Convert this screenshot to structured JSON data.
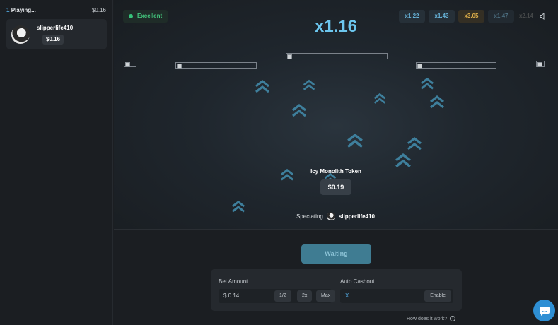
{
  "sidebar": {
    "playing_count": "1",
    "playing_label": "Playing...",
    "total": "$0.16",
    "players": [
      {
        "name": "slipperlife410",
        "bet": "$0.16"
      }
    ]
  },
  "game": {
    "status": "Excellent",
    "multiplier": "x1.16",
    "history": [
      "x1.22",
      "x1.43",
      "x3.05",
      "x1.47",
      "x2.14"
    ],
    "token_name": "Icy Monolith Token",
    "token_value": "$0.19",
    "spectating_label": "Spectating",
    "spectating_user": "slipperlife410"
  },
  "controls": {
    "wait_label": "Waiting",
    "bet_amount_label": "Bet Amount",
    "bet_amount_value": "$ 0.14",
    "half_label": "1/2",
    "double_label": "2x",
    "max_label": "Max",
    "auto_cashout_label": "Auto Cashout",
    "auto_cashout_value": "X",
    "enable_label": "Enable",
    "help_label": "How does it work?"
  },
  "colors": {
    "accent": "#6cc6ee",
    "status_green": "#36c27a",
    "gold": "#e0b04a",
    "chat_blue": "#2e8fd4"
  }
}
